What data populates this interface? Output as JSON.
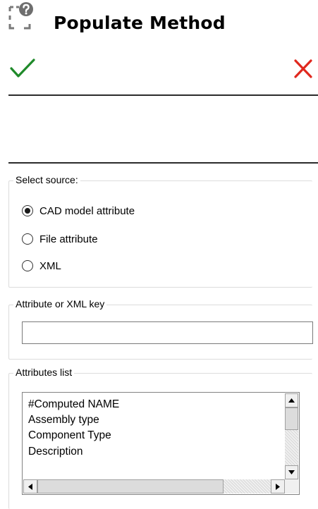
{
  "header": {
    "title": "Populate Method",
    "icon": "populate-method-icon",
    "ok_icon": "checkmark-icon",
    "cancel_icon": "close-icon",
    "ok_color": "#1f8a2a",
    "cancel_color": "#e0281e"
  },
  "source": {
    "label": "Select source:",
    "options": [
      {
        "label": "CAD model attribute",
        "checked": true
      },
      {
        "label": "File attribute",
        "checked": false
      },
      {
        "label": "XML",
        "checked": false
      }
    ]
  },
  "key": {
    "label": "Attribute or XML key",
    "value": ""
  },
  "attributes": {
    "label": "Attributes list",
    "items": [
      "#Computed NAME",
      "Assembly type",
      "Component Type",
      "Description"
    ]
  }
}
